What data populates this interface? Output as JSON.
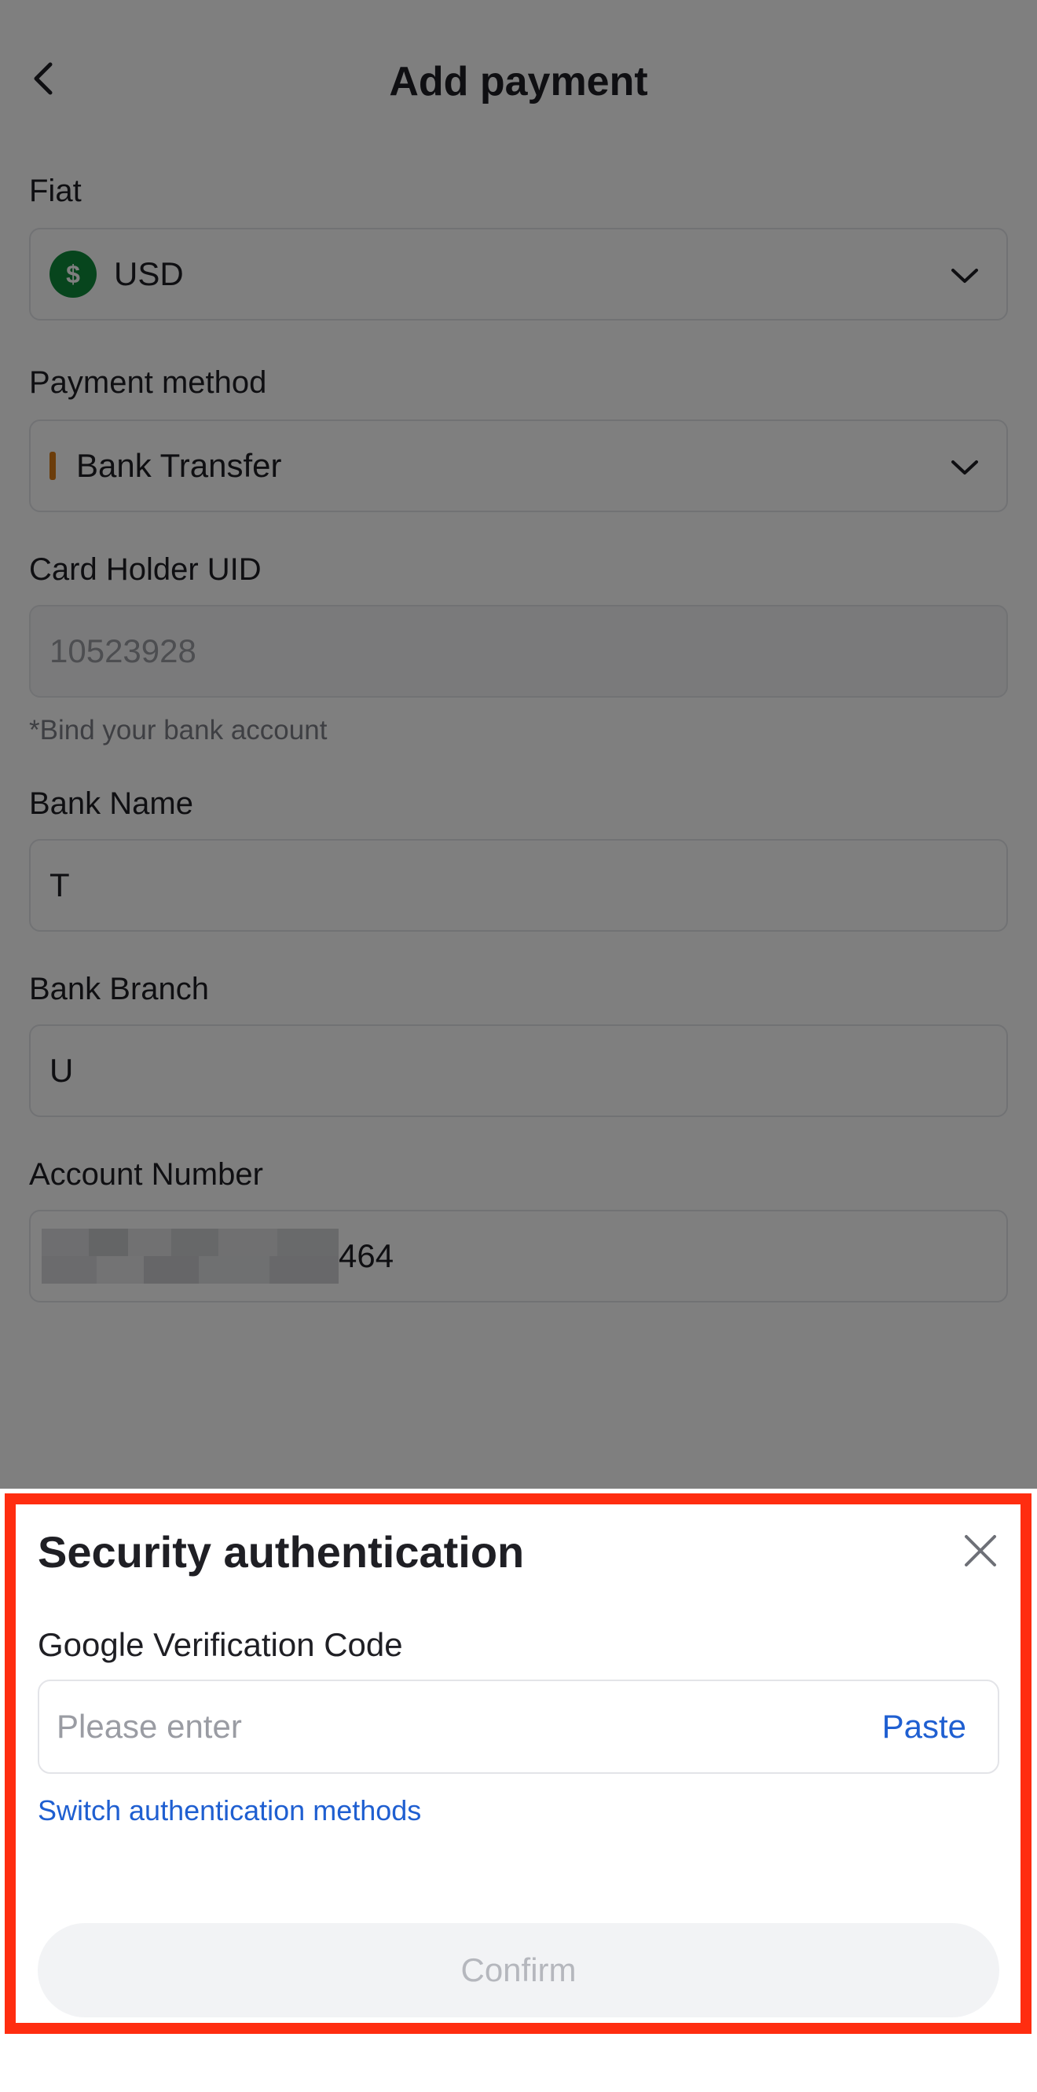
{
  "header": {
    "title": "Add payment"
  },
  "form": {
    "fiat": {
      "label": "Fiat",
      "value": "USD",
      "icon": "dollar-coin-icon",
      "icon_color": "#0e8a3a"
    },
    "payment_method": {
      "label": "Payment method",
      "value": "Bank Transfer",
      "accent_color": "#d87a16"
    },
    "card_holder_uid": {
      "label": "Card Holder UID",
      "value": "10523928",
      "hint": "*Bind your bank account"
    },
    "bank_name": {
      "label": "Bank Name",
      "value": "T"
    },
    "bank_branch": {
      "label": "Bank Branch",
      "value": "U"
    },
    "account_number": {
      "label": "Account Number",
      "visible_suffix": "464"
    }
  },
  "sheet": {
    "title": "Security authentication",
    "field_label": "Google Verification Code",
    "input_placeholder": "Please enter",
    "paste_label": "Paste",
    "switch_link": "Switch authentication methods",
    "confirm_label": "Confirm",
    "highlight_color": "#ff2d10",
    "link_color": "#1f5fd1"
  }
}
